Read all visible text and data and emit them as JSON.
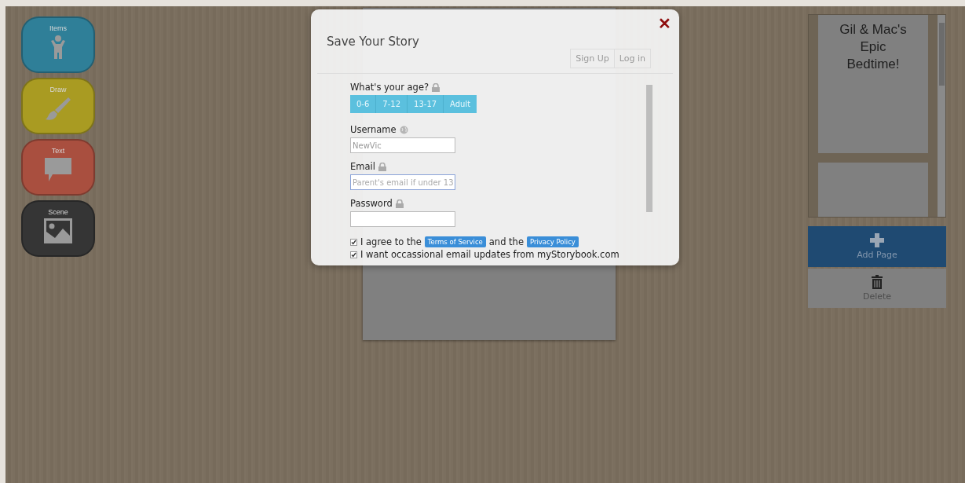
{
  "tools": [
    {
      "label": "Items",
      "kind": "items",
      "color": "#2f7f98"
    },
    {
      "label": "Draw",
      "kind": "draw",
      "color": "#a99b22"
    },
    {
      "label": "Text",
      "kind": "text",
      "color": "#a94f3f"
    },
    {
      "label": "Scene",
      "kind": "scene",
      "color": "#353535"
    }
  ],
  "pages": {
    "thumbnail_title": "Gil & Mac's Epic Bedtime!",
    "add_button": "Add Page",
    "delete_button": "Delete"
  },
  "dialog": {
    "title": "Save Your Story",
    "close": "✕",
    "tabs": [
      {
        "label": "Sign Up",
        "selected": false
      },
      {
        "label": "Log in",
        "selected": false
      }
    ],
    "age": {
      "label": "What's your age?",
      "options": [
        {
          "label": "0-6",
          "selected": false
        },
        {
          "label": "7-12",
          "selected": false
        },
        {
          "label": "13-17",
          "selected": false
        },
        {
          "label": "Adult",
          "selected": false
        }
      ]
    },
    "username": {
      "label": "Username",
      "value": "NewVic"
    },
    "email": {
      "label": "Email",
      "placeholder": "Parent's email if under 13"
    },
    "password": {
      "label": "Password"
    },
    "agree": {
      "checked": true,
      "before": "I agree to the",
      "terms": "Terms of Service",
      "middle": "and the",
      "privacy": "Privacy Policy"
    },
    "updates": {
      "checked": true,
      "label": "I want occassional email updates from myStorybook.com"
    }
  }
}
